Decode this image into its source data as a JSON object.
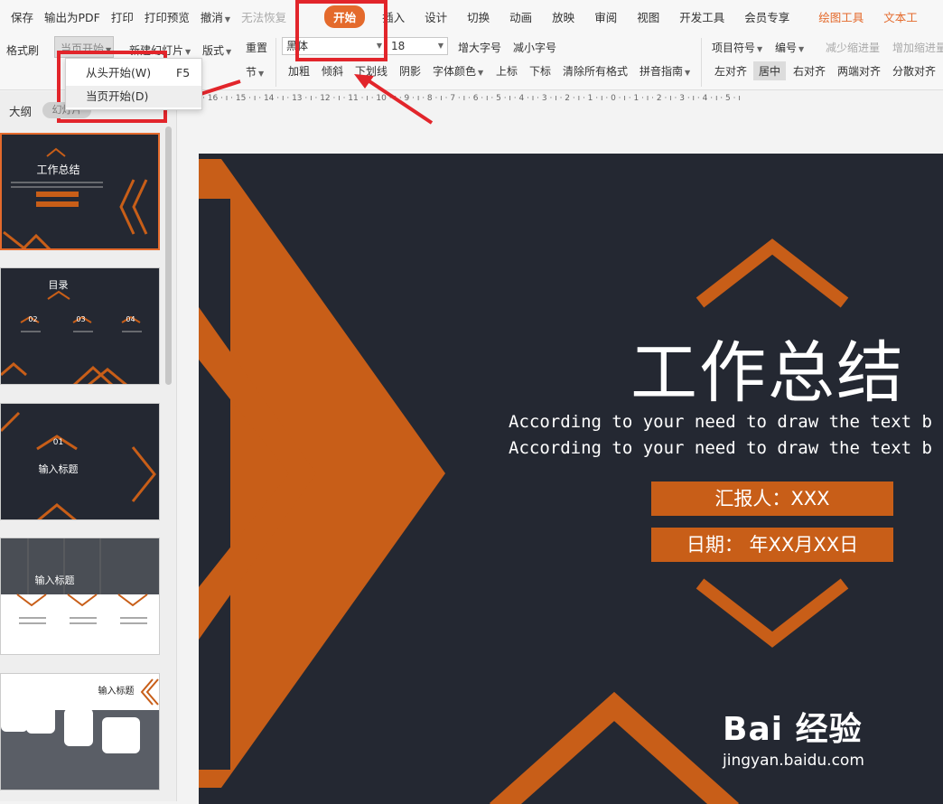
{
  "menu": {
    "save": "保存",
    "export_pdf": "输出为PDF",
    "print": "打印",
    "print_preview": "打印预览",
    "undo": "撤消",
    "redo": "无法恢复"
  },
  "tabs": {
    "home": "开始",
    "insert": "插入",
    "design": "设计",
    "transition": "切换",
    "animation": "动画",
    "slideshow": "放映",
    "review": "审阅",
    "view": "视图",
    "developer": "开发工具",
    "member": "会员专享",
    "drawing_tools": "绘图工具",
    "text_tools": "文本工"
  },
  "toolbar": {
    "format_painter": "格式刷",
    "from_current": "当页开始",
    "new_slide": "新建幻灯片",
    "layout": "版式",
    "reset": "重置",
    "section": "节",
    "font_name": "黑体",
    "font_size": "18",
    "increase_font": "增大字号",
    "decrease_font": "减小字号",
    "bold": "加粗",
    "italic": "倾斜",
    "underline": "下划线",
    "shadow": "阴影",
    "font_color": "字体颜色",
    "superscript": "上标",
    "subscript": "下标",
    "clear_format": "清除所有格式",
    "pinyin": "拼音指南",
    "bullets": "项目符号",
    "numbering": "编号",
    "decrease_indent": "减少缩进量",
    "increase_indent": "增加缩进量",
    "align_left": "左对齐",
    "align_center": "居中",
    "align_right": "右对齐",
    "justify": "两端对齐",
    "distributed": "分散对齐"
  },
  "dropdown": {
    "from_beginning": "从头开始(W)",
    "from_beginning_shortcut": "F5",
    "from_current": "当页开始(D)"
  },
  "panel": {
    "outline_label": "大纲",
    "tab_label": "幻灯片"
  },
  "ruler": {
    "text": "· 16 · ı · 15 · ı · 14 · ı · 13 · ı · 12 · ı · 11 · ı · 10 · ı · 9 · ı · 8 · ı · 7 · ı · 6 · ı · 5 · ı · 4 · ı · 3 · ı · 2 · ı · 1 · ı · 0 · ı · 1 · ı · 2 · ı · 3 · ı · 4 · ı · 5 · ı"
  },
  "thumbnails": {
    "s1_title": "工作总结",
    "s2_title": "目录",
    "s2_n1": "02",
    "s2_n2": "03",
    "s2_n3": "04",
    "s3_num": "01",
    "s3_title": "输入标题",
    "s4_title": "输入标题",
    "s5_title": "输入标题"
  },
  "slide": {
    "title": "工作总结",
    "subtitle_line1": "According to your need to draw the text b",
    "subtitle_line2": "According to your need to draw the text b",
    "reporter": "汇报人：XXX",
    "date": "日期：  年XX月XX日"
  },
  "watermark": {
    "brand": "Bai 经验",
    "url": "jingyan.baidu.com"
  },
  "colors": {
    "accent": "#e46a2c",
    "slide_bg": "#242832",
    "slide_orange": "#c85e18",
    "highlight_red": "#e2252b"
  }
}
